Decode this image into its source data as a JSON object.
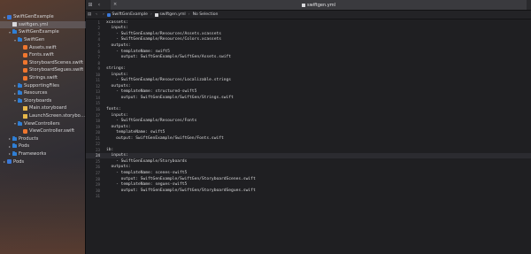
{
  "navigator": {
    "items": [
      {
        "label": "SwiftGenExample",
        "icon": "project-icon",
        "kind": "proj",
        "depth": 0,
        "disclosure": "▾",
        "selected": false
      },
      {
        "label": "swiftgen.yml",
        "icon": "yml-file-icon",
        "kind": "yml",
        "depth": 1,
        "disclosure": "",
        "selected": true
      },
      {
        "label": "SwiftGenExample",
        "icon": "folder-icon",
        "kind": "folder",
        "depth": 1,
        "disclosure": "▾",
        "selected": false
      },
      {
        "label": "SwiftGen",
        "icon": "folder-icon",
        "kind": "folder",
        "depth": 2,
        "disclosure": "▾",
        "selected": false
      },
      {
        "label": "Assets.swift",
        "icon": "swift-file-icon",
        "kind": "swift",
        "depth": 3,
        "disclosure": "",
        "selected": false
      },
      {
        "label": "Fonts.swift",
        "icon": "swift-file-icon",
        "kind": "swift",
        "depth": 3,
        "disclosure": "",
        "selected": false
      },
      {
        "label": "StoryboardScenes.swift",
        "icon": "swift-file-icon",
        "kind": "swift",
        "depth": 3,
        "disclosure": "",
        "selected": false
      },
      {
        "label": "StoryboardSegues.swift",
        "icon": "swift-file-icon",
        "kind": "swift",
        "depth": 3,
        "disclosure": "",
        "selected": false
      },
      {
        "label": "Strings.swift",
        "icon": "swift-file-icon",
        "kind": "swift",
        "depth": 3,
        "disclosure": "",
        "selected": false
      },
      {
        "label": "SupportingFiles",
        "icon": "folder-icon",
        "kind": "folder",
        "depth": 2,
        "disclosure": "▸",
        "selected": false
      },
      {
        "label": "Resources",
        "icon": "folder-icon",
        "kind": "folder",
        "depth": 2,
        "disclosure": "▸",
        "selected": false
      },
      {
        "label": "Storyboards",
        "icon": "folder-icon",
        "kind": "folder",
        "depth": 2,
        "disclosure": "▾",
        "selected": false
      },
      {
        "label": "Main.storyboard",
        "icon": "storyboard-file-icon",
        "kind": "sb",
        "depth": 3,
        "disclosure": "",
        "selected": false
      },
      {
        "label": "LaunchScreen.storyboard",
        "icon": "storyboard-file-icon",
        "kind": "sb",
        "depth": 3,
        "disclosure": "",
        "selected": false
      },
      {
        "label": "ViewControllers",
        "icon": "folder-icon",
        "kind": "folder",
        "depth": 2,
        "disclosure": "▾",
        "selected": false
      },
      {
        "label": "ViewController.swift",
        "icon": "swift-file-icon",
        "kind": "swift",
        "depth": 3,
        "disclosure": "",
        "selected": false
      },
      {
        "label": "Products",
        "icon": "folder-icon",
        "kind": "folder",
        "depth": 1,
        "disclosure": "▸",
        "selected": false
      },
      {
        "label": "Pods",
        "icon": "folder-icon",
        "kind": "folder",
        "depth": 1,
        "disclosure": "▸",
        "selected": false
      },
      {
        "label": "Frameworks",
        "icon": "folder-icon",
        "kind": "folder",
        "depth": 1,
        "disclosure": "▸",
        "selected": false
      },
      {
        "label": "Pods",
        "icon": "project-icon",
        "kind": "proj",
        "depth": 0,
        "disclosure": "▸",
        "selected": false
      }
    ]
  },
  "tabs": {
    "active_label": "swiftgen.yml",
    "back_glyph": "‹",
    "forward_glyph": "›",
    "grid_glyph": "⊞",
    "close_glyph": "×"
  },
  "jumpbar": {
    "crumbs": [
      "SwiftGenExample",
      "swiftgen.yml",
      "No Selection"
    ],
    "separator": "›"
  },
  "editor": {
    "current_line": 24,
    "lines": [
      "xcassets:",
      "  inputs:",
      "    - SwiftGenExample/Resources/Assets.xcassets",
      "    - SwiftGenExample/Resources/Colors.xcassets",
      "  outputs:",
      "    - templateName: swift5",
      "      output: SwiftGenExample/SwiftGen/Assets.swift",
      "",
      "strings:",
      "  inputs:",
      "    - SwiftGenExample/Resources/Localizable.strings",
      "  outputs:",
      "    - templateName: structured-swift5",
      "      output: SwiftGenExample/SwiftGen/Strings.swift",
      "",
      "fonts:",
      "  inputs:",
      "    - SwiftGenExample/Resources/Fonts",
      "  outputs:",
      "    templateName: swift5",
      "    output: SwiftGenExample/SwiftGen/Fonts.swift",
      "",
      "ib:",
      "  inputs:",
      "    - SwiftGenExample/Storyboards",
      "  outputs:",
      "    - templateName: scenes-swift5",
      "      output: SwiftGenExample/SwiftGen/StoryboardScenes.swift",
      "    - templateName: segues-swift5",
      "      output: SwiftGenExample/SwiftGen/StoryboardSegues.swift",
      ""
    ],
    "line_numbers": [
      "1",
      "2",
      "3",
      "4",
      "5",
      "6",
      "7",
      "8",
      "9",
      "10",
      "11",
      "12",
      "13",
      "14",
      "15",
      "16",
      "17",
      "18",
      "19",
      "20",
      "21",
      "22",
      "23",
      "24",
      "25",
      "26",
      "27",
      "28",
      "29",
      "30",
      "31"
    ]
  },
  "colors": {
    "accent": "#2f7fd6",
    "swift_orange": "#f0762e",
    "selection": "#5a5a62"
  }
}
